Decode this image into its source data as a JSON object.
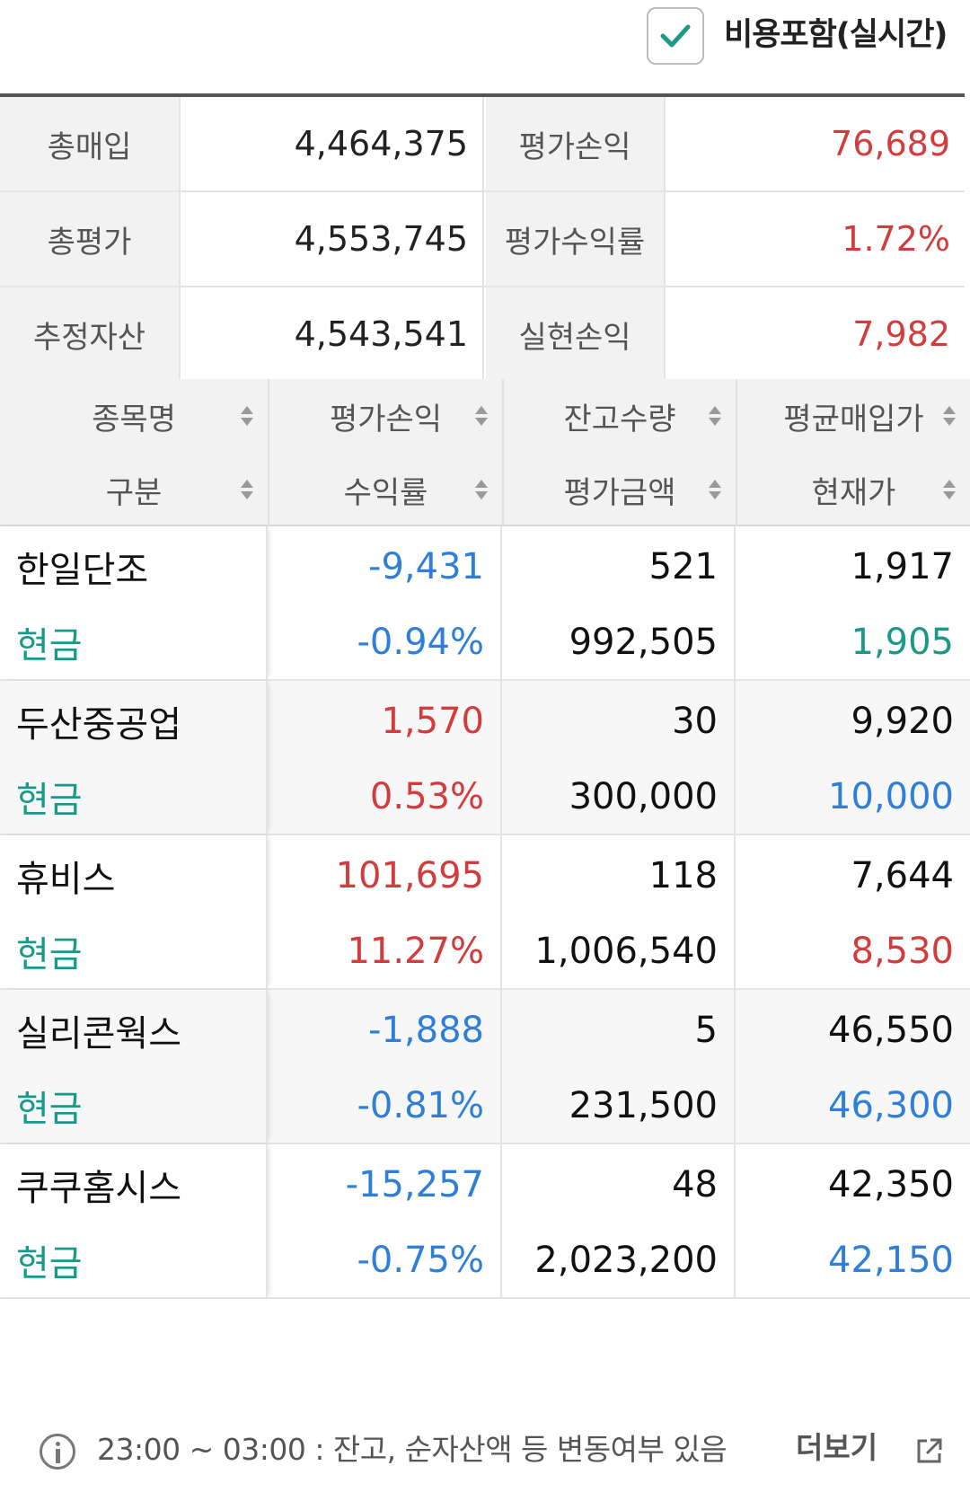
{
  "options": {
    "include_cost_label": "비용포함(실시간)",
    "include_cost_checked": true
  },
  "summary": {
    "rows": [
      {
        "label1": "총매입",
        "value1": "4,464,375",
        "label2": "평가손익",
        "value2": "76,689"
      },
      {
        "label1": "총평가",
        "value1": "4,553,745",
        "label2": "평가수익률",
        "value2": "1.72%"
      },
      {
        "label1": "추정자산",
        "value1": "4,543,541",
        "label2": "실현손익",
        "value2": "7,982"
      }
    ]
  },
  "holdings": {
    "headers": {
      "name": "종목명",
      "type": "구분",
      "pl": "평가손익",
      "rate": "수익률",
      "qty": "잔고수량",
      "eval": "평가금액",
      "avg": "평균매입가",
      "price": "현재가"
    },
    "rows": [
      {
        "name": "한일단조",
        "type": "현금",
        "pl": "-9,431",
        "rate": "-0.94%",
        "qty": "521",
        "eval": "992,505",
        "avg": "1,917",
        "price": "1,905"
      },
      {
        "name": "두산중공업",
        "type": "현금",
        "pl": "1,570",
        "rate": "0.53%",
        "qty": "30",
        "eval": "300,000",
        "avg": "9,920",
        "price": "10,000"
      },
      {
        "name": "휴비스",
        "type": "현금",
        "pl": "101,695",
        "rate": "11.27%",
        "qty": "118",
        "eval": "1,006,540",
        "avg": "7,644",
        "price": "8,530"
      },
      {
        "name": "실리콘웍스",
        "type": "현금",
        "pl": "-1,888",
        "rate": "-0.81%",
        "qty": "5",
        "eval": "231,500",
        "avg": "46,550",
        "price": "46,300"
      },
      {
        "name": "쿠쿠홈시스",
        "type": "현금",
        "pl": "-15,257",
        "rate": "-0.75%",
        "qty": "48",
        "eval": "2,023,200",
        "avg": "42,350",
        "price": "42,150"
      }
    ]
  },
  "footer": {
    "notice": "23:00 ~ 03:00 : 잔고, 순자산액 등 변동여부 있음",
    "more_label": "더보기"
  },
  "colors": {
    "positive": "#d23c3c",
    "negative": "#2f7fd8",
    "cash": "#1a9a86",
    "check": "#1a9a86"
  }
}
